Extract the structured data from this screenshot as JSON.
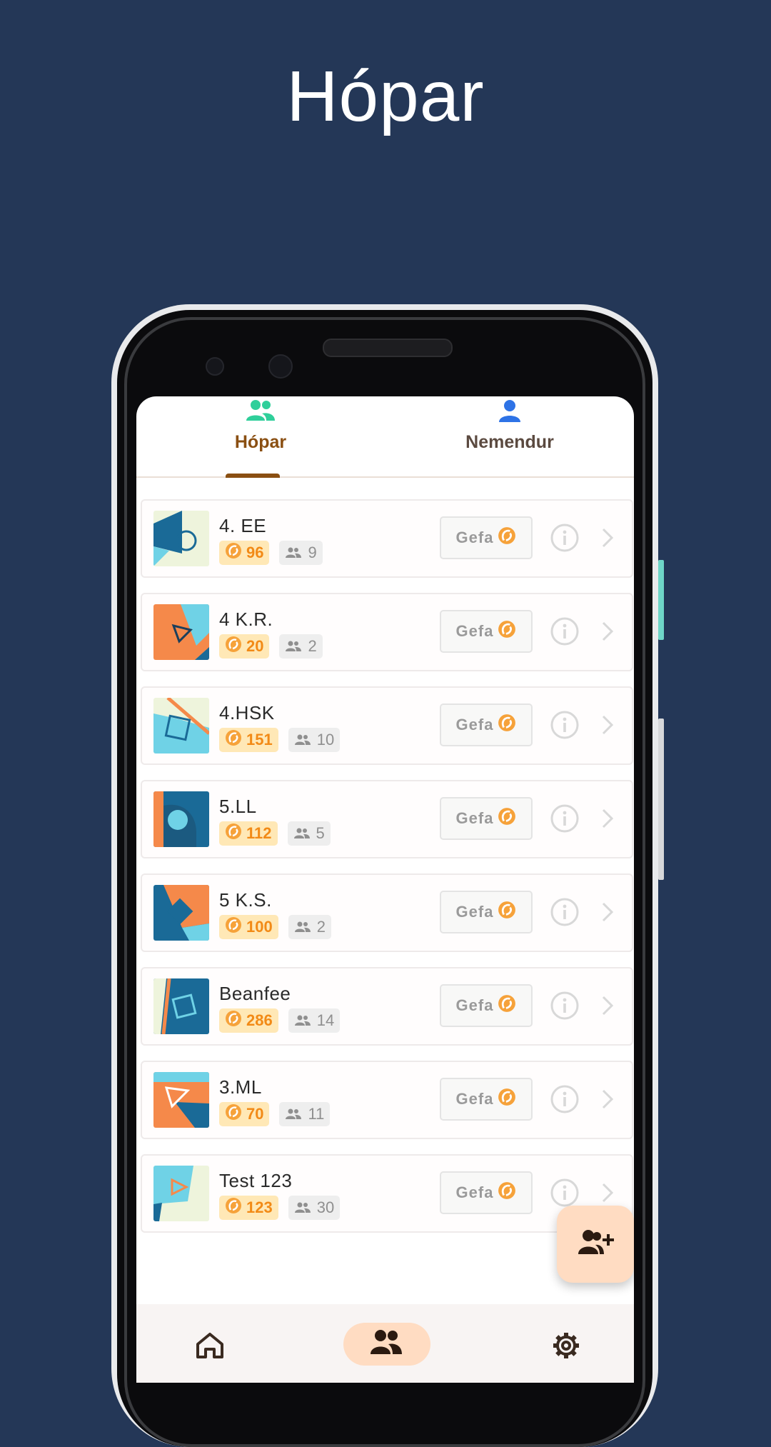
{
  "headline": "Hópar",
  "tabs": [
    {
      "label": "Hópar",
      "icon": "groups-icon",
      "active": true
    },
    {
      "label": "Nemendur",
      "icon": "person-icon",
      "active": false
    }
  ],
  "colors": {
    "background": "#243757",
    "accent_brown": "#8a4f12",
    "points_orange": "#f28a16",
    "points_bg": "#ffe8b6",
    "fab_bg": "#ffdcc2",
    "tab_icon_green": "#2fcf9a",
    "tab_icon_blue": "#2e73e6"
  },
  "groups": [
    {
      "name": "4. EE",
      "points": "96",
      "members": "9",
      "button": "Gefa",
      "avatar": "a1"
    },
    {
      "name": "4 K.R.",
      "points": "20",
      "members": "2",
      "button": "Gefa",
      "avatar": "a2"
    },
    {
      "name": "4.HSK",
      "points": "151",
      "members": "10",
      "button": "Gefa",
      "avatar": "a3"
    },
    {
      "name": "5.LL",
      "points": "112",
      "members": "5",
      "button": "Gefa",
      "avatar": "a4"
    },
    {
      "name": "5 K.S.",
      "points": "100",
      "members": "2",
      "button": "Gefa",
      "avatar": "a5"
    },
    {
      "name": "Beanfee",
      "points": "286",
      "members": "14",
      "button": "Gefa",
      "avatar": "a6"
    },
    {
      "name": "3.ML",
      "points": "70",
      "members": "11",
      "button": "Gefa",
      "avatar": "a7"
    },
    {
      "name": "Test 123",
      "points": "123",
      "members": "30",
      "button": "Gefa",
      "avatar": "a8"
    }
  ],
  "fab": {
    "icon": "add-person-icon"
  },
  "bottom_nav": [
    {
      "icon": "home-icon",
      "active": false
    },
    {
      "icon": "groups-icon",
      "active": true
    },
    {
      "icon": "settings-icon",
      "active": false
    }
  ]
}
